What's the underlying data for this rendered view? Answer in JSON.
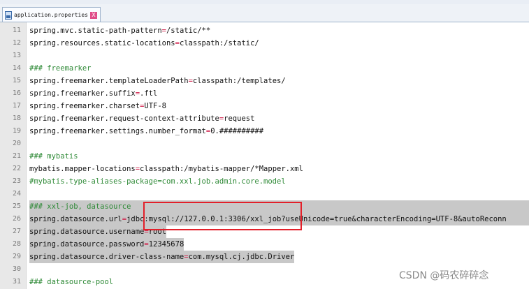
{
  "tab": {
    "title": "application.properties",
    "close_glyph": "X"
  },
  "lines": [
    {
      "num": "11",
      "key": "spring.mvc.static-path-pattern",
      "op": "=",
      "val": "/static/**",
      "comment": ""
    },
    {
      "num": "12",
      "key": "spring.resources.static-locations",
      "op": "=",
      "val": "classpath:/static/",
      "comment": ""
    },
    {
      "num": "13",
      "key": "",
      "op": "",
      "val": "",
      "comment": ""
    },
    {
      "num": "14",
      "key": "",
      "op": "",
      "val": "",
      "comment": "### freemarker"
    },
    {
      "num": "15",
      "key": "spring.freemarker.templateLoaderPath",
      "op": "=",
      "val": "classpath:/templates/",
      "comment": ""
    },
    {
      "num": "16",
      "key": "spring.freemarker.suffix",
      "op": "=",
      "val": ".ftl",
      "comment": ""
    },
    {
      "num": "17",
      "key": "spring.freemarker.charset",
      "op": "=",
      "val": "UTF-8",
      "comment": ""
    },
    {
      "num": "18",
      "key": "spring.freemarker.request-context-attribute",
      "op": "=",
      "val": "request",
      "comment": ""
    },
    {
      "num": "19",
      "key": "spring.freemarker.settings.number_format",
      "op": "=",
      "val": "0.##########",
      "comment": ""
    },
    {
      "num": "20",
      "key": "",
      "op": "",
      "val": "",
      "comment": ""
    },
    {
      "num": "21",
      "key": "",
      "op": "",
      "val": "",
      "comment": "### mybatis"
    },
    {
      "num": "22",
      "key": "mybatis.mapper-locations",
      "op": "=",
      "val": "classpath:/mybatis-mapper/*Mapper.xml",
      "comment": ""
    },
    {
      "num": "23",
      "key": "",
      "op": "",
      "val": "",
      "comment": "#mybatis.type-aliases-package=com.xxl.job.admin.core.model"
    },
    {
      "num": "24",
      "key": "",
      "op": "",
      "val": "",
      "comment": ""
    },
    {
      "num": "25",
      "key": "",
      "op": "",
      "val": "",
      "comment": "### xxl-job, datasource"
    },
    {
      "num": "26",
      "key": "spring.datasource.url",
      "op": "=",
      "val": "jdbc:mysql://127.0.0.1:3306/xxl_job?useUnicode=true&characterEncoding=UTF-8&autoReconn",
      "comment": ""
    },
    {
      "num": "27",
      "key": "spring.datasource.username",
      "op": "=",
      "val": "root",
      "comment": ""
    },
    {
      "num": "28",
      "key": "spring.datasource.password",
      "op": "=",
      "val": "12345678",
      "comment": ""
    },
    {
      "num": "29",
      "key": "spring.datasource.driver-class-name",
      "op": "=",
      "val": "com.mysql.cj.jdbc.Driver",
      "comment": ""
    },
    {
      "num": "30",
      "key": "",
      "op": "",
      "val": "",
      "comment": ""
    },
    {
      "num": "31",
      "key": "",
      "op": "",
      "val": "",
      "comment": "### datasource-pool"
    }
  ],
  "watermark": "CSDN @码农碎碎念",
  "colors": {
    "operator": "#d0204a",
    "comment": "#2f8a37",
    "annotation_box": "#e3202a",
    "selection": "#c8c8c8"
  }
}
